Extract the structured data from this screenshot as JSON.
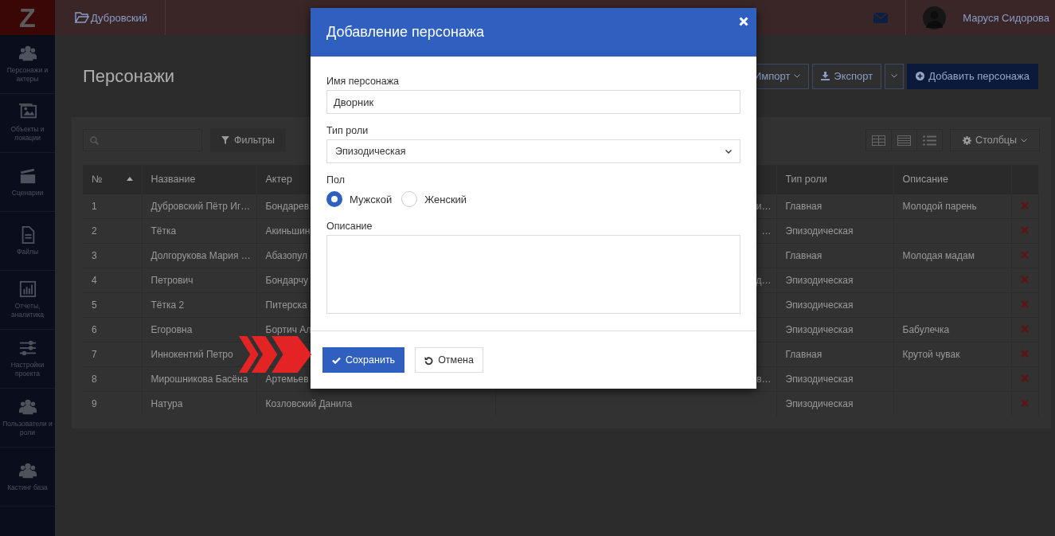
{
  "sidebar": {
    "logo": "Z",
    "items": [
      {
        "label": "Персонажи и актеры",
        "kind": "people"
      },
      {
        "label": "Объекты и локации",
        "kind": "image"
      },
      {
        "label": "Сценарии",
        "kind": "clapper"
      },
      {
        "label": "Файлы",
        "kind": "file"
      },
      {
        "label": "Отчеты, аналитика",
        "kind": "chart"
      },
      {
        "label": "Настройки проекта",
        "kind": "sliders"
      },
      {
        "label": "Пользователи и роли",
        "kind": "people"
      },
      {
        "label": "Кастинг база",
        "kind": "people"
      }
    ]
  },
  "topbar": {
    "project": "Дубровский",
    "user": "Маруся Сидорова"
  },
  "page": {
    "title": "Персонажи",
    "actions": [
      {
        "label": "Импорт",
        "kind": "dropdown"
      },
      {
        "label": "Экспорт",
        "kind": "split"
      },
      {
        "label": "Добавить персонажа",
        "kind": "primary"
      }
    ]
  },
  "toolbar": {
    "filter": "Фильтры",
    "columns_button": "Столбцы",
    "views": [
      {
        "kind": "grid"
      },
      {
        "kind": "rows"
      },
      {
        "kind": "list"
      }
    ]
  },
  "table": {
    "columns": [
      {
        "label": "№",
        "sorted": true
      },
      {
        "label": "Название",
        "sorted": false
      },
      {
        "label": "Актер",
        "sorted": false
      },
      {
        "label": "Тип роли",
        "sorted": false
      },
      {
        "label": "Описание",
        "sorted": false
      }
    ],
    "rows": [
      {
        "number": "1",
        "name": "Дубровский Пётр Иг…",
        "actor": "Бондарев",
        "column_4": "и…",
        "role": "Главная",
        "description": "Молодой парень"
      },
      {
        "number": "2",
        "name": "Тётка",
        "actor": "Акиньшин",
        "column_4": "…",
        "role": "Эпизодическая"
      },
      {
        "number": "3",
        "name": "Долгорукова Мария …",
        "actor": "Абазопул",
        "role": "Главная",
        "description": "Молодая мадам"
      },
      {
        "number": "4",
        "name": "Петрович",
        "actor": "Бондарчу",
        "column_4": "д…",
        "role": "Эпизодическая"
      },
      {
        "number": "5",
        "name": "Тётка 2",
        "actor": "Питерска",
        "role": "Эпизодическая"
      },
      {
        "number": "6",
        "name": "Егоровна",
        "actor": "Бортич Ал",
        "role": "Эпизодическая",
        "description": "Бабулечка"
      },
      {
        "number": "7",
        "name": "Иннокентий Петро",
        "role": "Главная",
        "description": "Крутой чувак"
      },
      {
        "number": "8",
        "name": "Мирошникова Басёна",
        "actor": "Артемьев",
        "column_4": "в…",
        "role": "Эпизодическая"
      },
      {
        "number": "9",
        "name": "Натура",
        "actor": "Козловский Данила",
        "role": "Эпизодическая"
      }
    ]
  },
  "modal": {
    "title": "Добавление персонажа",
    "fields": [
      {
        "kind": "text",
        "label": "Имя персонажа",
        "value": "Дворник"
      },
      {
        "kind": "select",
        "label": "Тип роли",
        "value": "Эпизодическая"
      },
      {
        "kind": "radio",
        "label": "Пол",
        "options": [
          {
            "label": "Мужской",
            "selected": true
          },
          {
            "label": "Женский",
            "selected": false
          }
        ]
      },
      {
        "kind": "textarea",
        "label": "Описание"
      }
    ],
    "buttons": [
      {
        "label": "Сохранить",
        "kind": "primary"
      },
      {
        "label": "Отмена",
        "kind": "default"
      }
    ]
  }
}
